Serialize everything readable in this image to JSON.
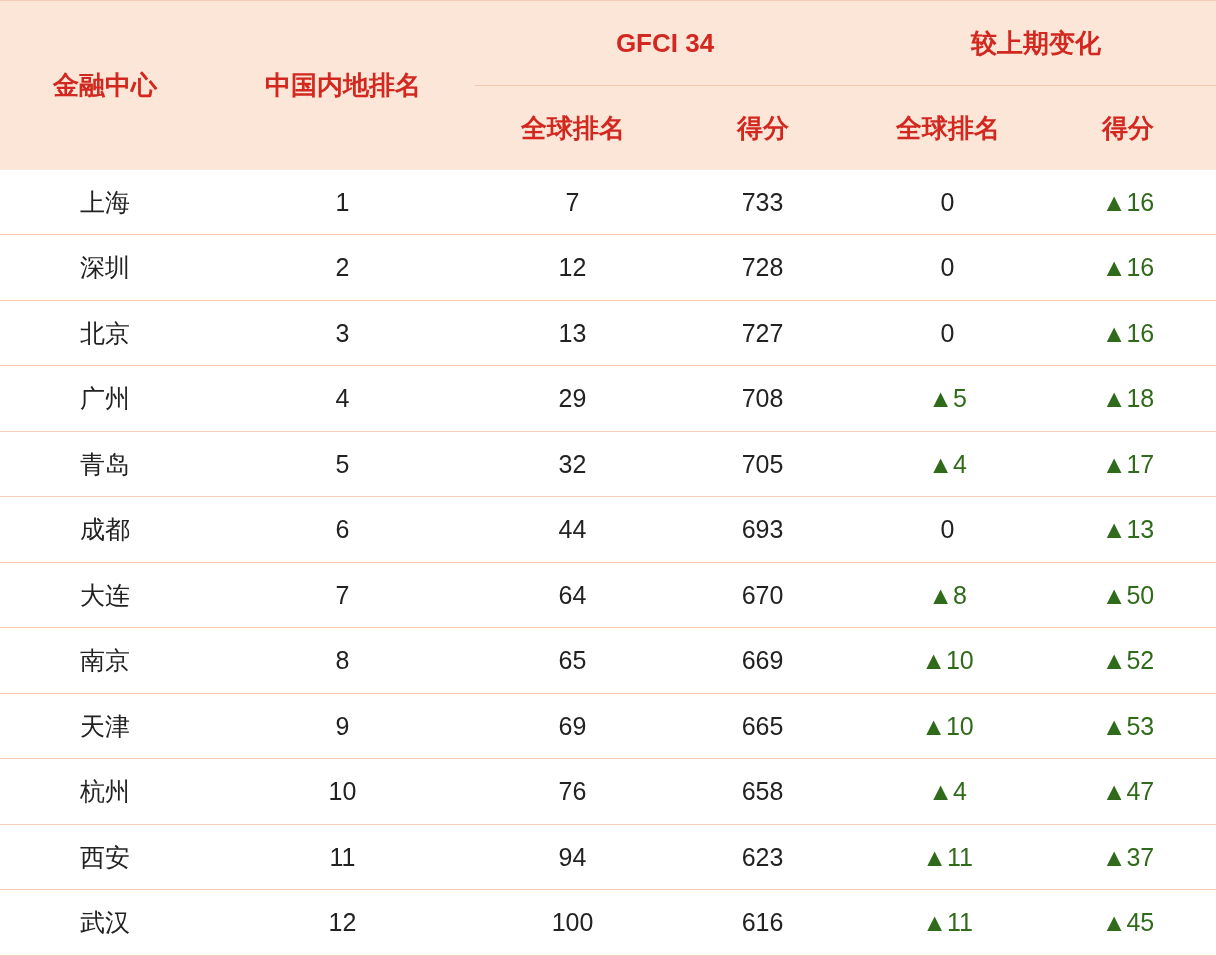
{
  "table": {
    "columns": {
      "center": "金融中心",
      "domestic_rank": "中国内地排名",
      "gfci_group": "GFCI  34",
      "change_group": "较上期变化",
      "gfci_sub": [
        "全球排名",
        "得分"
      ],
      "change_sub": [
        "全球排名",
        "得分"
      ]
    },
    "rows": [
      {
        "city": "上海",
        "domestic_rank": "1",
        "global_rank": "7",
        "score": "733",
        "rank_change": {
          "text": "0",
          "kind": "flat"
        },
        "score_change": {
          "text": "▲16",
          "kind": "rise"
        }
      },
      {
        "city": "深圳",
        "domestic_rank": "2",
        "global_rank": "12",
        "score": "728",
        "rank_change": {
          "text": "0",
          "kind": "flat"
        },
        "score_change": {
          "text": "▲16",
          "kind": "rise"
        }
      },
      {
        "city": "北京",
        "domestic_rank": "3",
        "global_rank": "13",
        "score": "727",
        "rank_change": {
          "text": "0",
          "kind": "flat"
        },
        "score_change": {
          "text": "▲16",
          "kind": "rise"
        }
      },
      {
        "city": "广州",
        "domestic_rank": "4",
        "global_rank": "29",
        "score": "708",
        "rank_change": {
          "text": "▲5",
          "kind": "rise"
        },
        "score_change": {
          "text": "▲18",
          "kind": "rise"
        }
      },
      {
        "city": "青岛",
        "domestic_rank": "5",
        "global_rank": "32",
        "score": "705",
        "rank_change": {
          "text": "▲4",
          "kind": "rise"
        },
        "score_change": {
          "text": "▲17",
          "kind": "rise"
        }
      },
      {
        "city": "成都",
        "domestic_rank": "6",
        "global_rank": "44",
        "score": "693",
        "rank_change": {
          "text": "0",
          "kind": "flat"
        },
        "score_change": {
          "text": "▲13",
          "kind": "rise"
        }
      },
      {
        "city": "大连",
        "domestic_rank": "7",
        "global_rank": "64",
        "score": "670",
        "rank_change": {
          "text": "▲8",
          "kind": "rise"
        },
        "score_change": {
          "text": "▲50",
          "kind": "rise"
        }
      },
      {
        "city": "南京",
        "domestic_rank": "8",
        "global_rank": "65",
        "score": "669",
        "rank_change": {
          "text": "▲10",
          "kind": "rise"
        },
        "score_change": {
          "text": "▲52",
          "kind": "rise"
        }
      },
      {
        "city": "天津",
        "domestic_rank": "9",
        "global_rank": "69",
        "score": "665",
        "rank_change": {
          "text": "▲10",
          "kind": "rise"
        },
        "score_change": {
          "text": "▲53",
          "kind": "rise"
        }
      },
      {
        "city": "杭州",
        "domestic_rank": "10",
        "global_rank": "76",
        "score": "658",
        "rank_change": {
          "text": "▲4",
          "kind": "rise"
        },
        "score_change": {
          "text": "▲47",
          "kind": "rise"
        }
      },
      {
        "city": "西安",
        "domestic_rank": "11",
        "global_rank": "94",
        "score": "623",
        "rank_change": {
          "text": "▲11",
          "kind": "rise"
        },
        "score_change": {
          "text": "▲37",
          "kind": "rise"
        }
      },
      {
        "city": "武汉",
        "domestic_rank": "12",
        "global_rank": "100",
        "score": "616",
        "rank_change": {
          "text": "▲11",
          "kind": "rise"
        },
        "score_change": {
          "text": "▲45",
          "kind": "rise"
        }
      }
    ]
  }
}
